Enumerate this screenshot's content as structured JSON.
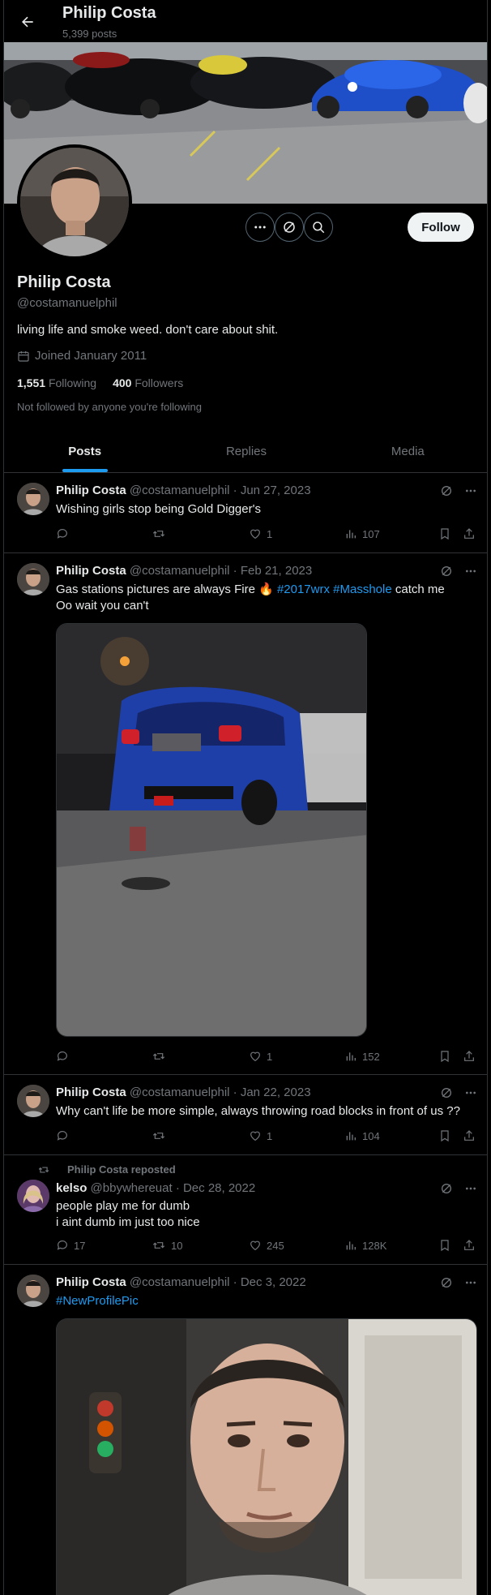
{
  "header": {
    "name": "Philip Costa",
    "posts_count": "5,399 posts"
  },
  "profile": {
    "name": "Philip Costa",
    "handle": "@costamanuelphil",
    "bio": "living life and smoke weed. don't care about shit.",
    "joined": "Joined January 2011",
    "following_count": "1,551",
    "following_label": "Following",
    "followers_count": "400",
    "followers_label": "Followers",
    "not_followed": "Not followed by anyone you're following",
    "follow_label": "Follow"
  },
  "tabs": [
    {
      "label": "Posts",
      "active": true
    },
    {
      "label": "Replies",
      "active": false
    },
    {
      "label": "Media",
      "active": false
    }
  ],
  "posts": [
    {
      "name": "Philip Costa",
      "meta": "@costamanuelphil · Jun 27, 2023",
      "text": "Wishing girls stop being Gold Digger's",
      "replies": "",
      "reposts": "",
      "likes": "1",
      "views": "107"
    },
    {
      "name": "Philip Costa",
      "meta": "@costamanuelphil · Feb 21, 2023",
      "text_pre": "Gas stations pictures are always Fire 🔥 ",
      "tag1": "#2017wrx",
      "tag2": "#Masshole",
      "text_post": " catch me Oo wait you can't",
      "replies": "",
      "reposts": "",
      "likes": "1",
      "views": "152"
    },
    {
      "name": "Philip Costa",
      "meta": "@costamanuelphil · Jan 22, 2023",
      "text": "Why can't life be more simple, always throwing road blocks in front of us ??",
      "replies": "",
      "reposts": "",
      "likes": "1",
      "views": "104"
    },
    {
      "repost_label": "Philip Costa reposted",
      "name": "kelso",
      "meta": "@bbywhereuat · Dec 28, 2022",
      "line1": "people play me for dumb",
      "line2": "i aint dumb im just too nice",
      "replies": "17",
      "reposts": "10",
      "likes": "245",
      "views": "128K"
    },
    {
      "name": "Philip Costa",
      "meta": "@costamanuelphil · Dec 3, 2022",
      "tag": "#NewProfilePic"
    }
  ],
  "colors": {
    "accent": "#1d9bf0",
    "muted": "#71767b",
    "border": "#2f3336"
  }
}
